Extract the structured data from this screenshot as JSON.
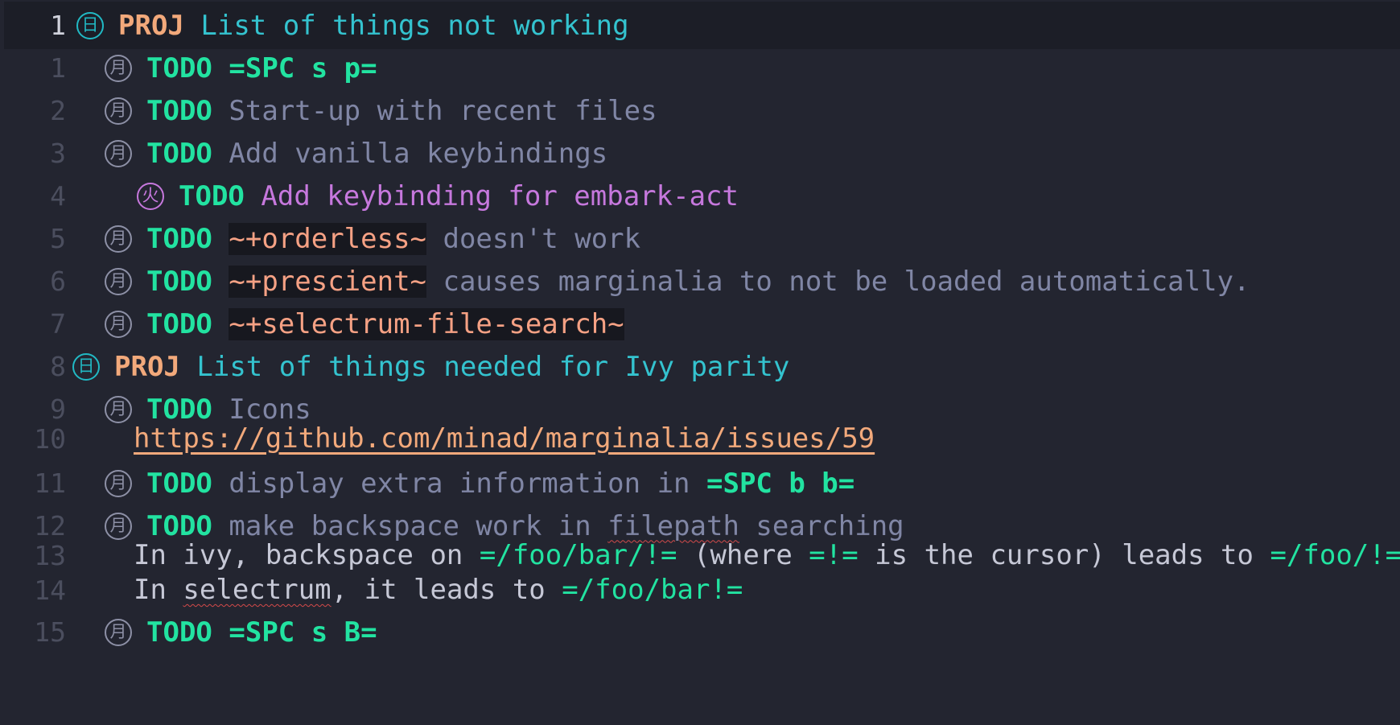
{
  "lines": [
    {
      "num": "1",
      "bullet": "日",
      "keyword": "PROJ",
      "title": "List of things not working"
    },
    {
      "num": "1",
      "bullet": "月",
      "keyword": "TODO",
      "verbatim": "=SPC s p="
    },
    {
      "num": "2",
      "bullet": "月",
      "keyword": "TODO",
      "title": "Start-up with recent files"
    },
    {
      "num": "3",
      "bullet": "月",
      "keyword": "TODO",
      "title": "Add vanilla keybindings"
    },
    {
      "num": "4",
      "bullet": "火",
      "keyword": "TODO",
      "title": "Add keybinding for embark-act"
    },
    {
      "num": "5",
      "bullet": "月",
      "keyword": "TODO",
      "code": "~+orderless~",
      "rest": " doesn't work"
    },
    {
      "num": "6",
      "bullet": "月",
      "keyword": "TODO",
      "code": "~+prescient~",
      "rest": " causes marginalia to not be loaded automatically."
    },
    {
      "num": "7",
      "bullet": "月",
      "keyword": "TODO",
      "code": "~+selectrum-file-search~"
    },
    {
      "num": "8",
      "bullet": "日",
      "keyword": "PROJ",
      "title": "List of things needed for Ivy parity"
    },
    {
      "num": "9",
      "bullet": "月",
      "keyword": "TODO",
      "title": "Icons"
    },
    {
      "num": "10",
      "link": "https://github.com/minad/marginalia/issues/59"
    },
    {
      "num": "11",
      "bullet": "月",
      "keyword": "TODO",
      "title": "display extra information in ",
      "verbatim": "=SPC b b="
    },
    {
      "num": "12",
      "bullet": "月",
      "keyword": "TODO",
      "title_a": "make backspace work in ",
      "title_spell": "filepath",
      "title_b": " searching"
    },
    {
      "num": "13",
      "t1": "In ivy, backspace on ",
      "v1": "=/foo/bar/!=",
      "t2": " (where ",
      "v2": "=!=",
      "t3": " is the cursor) leads to ",
      "v3": "=/foo/!="
    },
    {
      "num": "14",
      "t1": "In ",
      "spell": "selectrum",
      "t2": ", it leads to ",
      "v1": "=/foo/bar!="
    },
    {
      "num": "15",
      "bullet": "月",
      "keyword": "TODO",
      "verbatim": "=SPC s B="
    }
  ]
}
